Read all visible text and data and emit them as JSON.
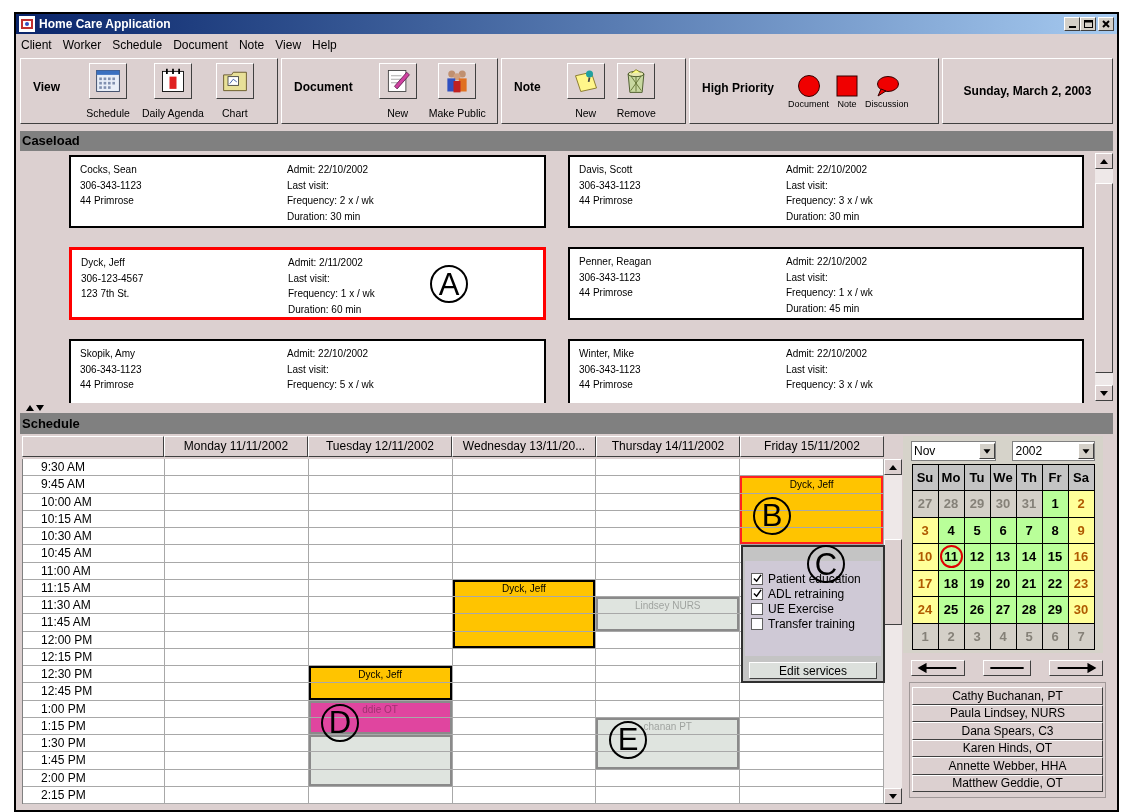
{
  "window": {
    "title": "Home Care Application"
  },
  "menu": [
    "Client",
    "Worker",
    "Schedule",
    "Document",
    "Note",
    "View",
    "Help"
  ],
  "toolbar": {
    "groups": [
      {
        "label": "View",
        "buttons": [
          {
            "label": "Schedule",
            "kind": "calendar"
          },
          {
            "label": "Daily Agenda",
            "kind": "agenda"
          },
          {
            "label": "Chart",
            "kind": "folder"
          }
        ]
      },
      {
        "label": "Document",
        "buttons": [
          {
            "label": "New",
            "kind": "pen"
          },
          {
            "label": "Make Public",
            "kind": "people"
          }
        ]
      },
      {
        "label": "Note",
        "buttons": [
          {
            "label": "New",
            "kind": "note"
          },
          {
            "label": "Remove",
            "kind": "trash"
          }
        ]
      }
    ],
    "high_priority": {
      "label": "High Priority",
      "items": [
        {
          "label": "Document",
          "kind": "circle"
        },
        {
          "label": "Note",
          "kind": "square"
        },
        {
          "label": "Discussion",
          "kind": "bubble"
        }
      ]
    },
    "date": "Sunday, March 2, 2003"
  },
  "caseload": {
    "title": "Caseload",
    "clients": [
      {
        "name": "Cocks, Sean",
        "phone": "306-343-1123",
        "address": "44 Primrose",
        "admit": "Admit: 22/10/2002",
        "last_visit": "Last visit:",
        "frequency": "Frequency: 2 x / wk",
        "duration": "Duration: 30 min",
        "selected": false
      },
      {
        "name": "Davis, Scott",
        "phone": "306-343-1123",
        "address": "44 Primrose",
        "admit": "Admit: 22/10/2002",
        "last_visit": "Last visit:",
        "frequency": "Frequency: 3 x / wk",
        "duration": "Duration: 30 min",
        "selected": false
      },
      {
        "name": "Dyck, Jeff",
        "phone": "306-123-4567",
        "address": "123 7th St.",
        "admit": "Admit: 2/11/2002",
        "last_visit": "Last visit:",
        "frequency": "Frequency: 1 x / wk",
        "duration": "Duration: 60 min",
        "selected": true,
        "callout": "A"
      },
      {
        "name": "Penner, Reagan",
        "phone": "306-343-1123",
        "address": "44 Primrose",
        "admit": "Admit: 22/10/2002",
        "last_visit": "Last visit:",
        "frequency": "Frequency: 1 x / wk",
        "duration": "Duration: 45 min",
        "selected": false
      },
      {
        "name": "Skopik, Amy",
        "phone": "306-343-1123",
        "address": "44 Primrose",
        "admit": "Admit: 22/10/2002",
        "last_visit": "Last visit:",
        "frequency": "Frequency: 5 x / wk",
        "selected": false
      },
      {
        "name": "Winter, Mike",
        "phone": "306-343-1123",
        "address": "44 Primrose",
        "admit": "Admit: 22/10/2002",
        "last_visit": "Last visit:",
        "frequency": "Frequency: 3 x / wk",
        "selected": false
      }
    ]
  },
  "schedule": {
    "title": "Schedule",
    "days": [
      "Monday 11/11/2002",
      "Tuesday 12/11/2002",
      "Wednesday 13/11/20...",
      "Thursday 14/11/2002",
      "Friday 15/11/2002"
    ],
    "rows": [
      {
        "time": "9:30 AM",
        "cells": [
          {},
          {},
          {},
          {},
          {}
        ]
      },
      {
        "time": "9:45 AM",
        "cells": [
          {},
          {},
          {},
          {},
          {
            "kind": "client",
            "color": "#ffc400",
            "selected": true,
            "label": "Dyck, Jeff"
          }
        ]
      },
      {
        "time": "10:00 AM",
        "cells": [
          {},
          {},
          {},
          {},
          {
            "kind": "client",
            "color": "#ffc400",
            "selected": true,
            "callout": "B"
          }
        ]
      },
      {
        "time": "10:15 AM",
        "cells": [
          {},
          {},
          {},
          {},
          {
            "kind": "client",
            "color": "#ffc400",
            "selected": true
          }
        ]
      },
      {
        "time": "10:30 AM",
        "cells": [
          {},
          {},
          {},
          {},
          {
            "kind": "client",
            "color": "#ffc400",
            "selected": true
          }
        ]
      },
      {
        "time": "10:45 AM",
        "cells": [
          {},
          {},
          {},
          {},
          {}
        ]
      },
      {
        "time": "11:00 AM",
        "cells": [
          {},
          {},
          {},
          {},
          {}
        ]
      },
      {
        "time": "11:15 AM",
        "cells": [
          {},
          {},
          {
            "kind": "client",
            "color": "#ffc400",
            "selected": false,
            "label": "Dyck, Jeff"
          },
          {},
          {}
        ]
      },
      {
        "time": "11:30 AM",
        "cells": [
          {},
          {},
          {
            "kind": "client",
            "color": "#ffc400",
            "selected": false
          },
          {
            "kind": "worker",
            "color": "#dfe4df",
            "selected": false,
            "label": "Lindsey NURS"
          },
          {}
        ]
      },
      {
        "time": "11:45 AM",
        "cells": [
          {},
          {},
          {
            "kind": "client",
            "color": "#ffc400",
            "selected": false
          },
          {
            "kind": "worker",
            "color": "#dfe4df",
            "selected": false
          },
          {}
        ]
      },
      {
        "time": "12:00 PM",
        "cells": [
          {},
          {},
          {
            "kind": "client",
            "color": "#ffc400",
            "selected": false
          },
          {},
          {}
        ]
      },
      {
        "time": "12:15 PM",
        "cells": [
          {},
          {},
          {},
          {},
          {}
        ]
      },
      {
        "time": "12:30 PM",
        "cells": [
          {},
          {
            "kind": "client",
            "color": "#ffc400",
            "selected": false,
            "label": "Dyck, Jeff"
          },
          {},
          {},
          {}
        ]
      },
      {
        "time": "12:45 PM",
        "cells": [
          {},
          {
            "kind": "client",
            "color": "#ffc400",
            "selected": false
          },
          {},
          {},
          {}
        ]
      },
      {
        "time": "1:00 PM",
        "cells": [
          {},
          {
            "kind": "worker",
            "color": "#e0459f",
            "selected": false,
            "label": "ddie OT",
            "callout": "D"
          },
          {},
          {},
          {}
        ]
      },
      {
        "time": "1:15 PM",
        "cells": [
          {},
          {
            "kind": "worker",
            "color": "#e0459f",
            "selected": false
          },
          {},
          {
            "kind": "worker",
            "color": "#dfe4df",
            "selected": false,
            "label": "chanan PT",
            "callout": "E"
          },
          {}
        ]
      },
      {
        "time": "1:30 PM",
        "cells": [
          {},
          {
            "kind": "worker",
            "color": "#dfe4df",
            "selected": false
          },
          {},
          {
            "kind": "worker",
            "color": "#dfe4df",
            "selected": false
          },
          {}
        ]
      },
      {
        "time": "1:45 PM",
        "cells": [
          {},
          {
            "kind": "worker",
            "color": "#dfe4df",
            "selected": false
          },
          {},
          {
            "kind": "worker",
            "color": "#dfe4df",
            "selected": false
          },
          {}
        ]
      },
      {
        "time": "2:00 PM",
        "cells": [
          {},
          {
            "kind": "worker",
            "color": "#dfe4df",
            "selected": false
          },
          {},
          {},
          {}
        ]
      },
      {
        "time": "2:15 PM",
        "cells": [
          {},
          {},
          {},
          {},
          {}
        ]
      }
    ],
    "popup": {
      "services": [
        {
          "label": "Patient education",
          "checked": true
        },
        {
          "label": "ADL retraining",
          "checked": true
        },
        {
          "label": "UE Exercise",
          "checked": false
        },
        {
          "label": "Transfer training",
          "checked": false
        }
      ],
      "button": "Edit services",
      "callout": "C"
    }
  },
  "calendar": {
    "month": "Nov",
    "year": "2002",
    "weekdays": [
      "Su",
      "Mo",
      "Tu",
      "We",
      "Th",
      "Fr",
      "Sa"
    ],
    "weeks": [
      [
        {
          "day": "27",
          "kind": "other",
          "selected": false
        },
        {
          "day": "28",
          "kind": "other",
          "selected": false
        },
        {
          "day": "29",
          "kind": "other",
          "selected": false
        },
        {
          "day": "30",
          "kind": "other",
          "selected": false
        },
        {
          "day": "31",
          "kind": "other",
          "selected": false
        },
        {
          "day": "1",
          "kind": "weekday",
          "selected": false
        },
        {
          "day": "2",
          "kind": "weekend",
          "selected": false
        }
      ],
      [
        {
          "day": "3",
          "kind": "weekend",
          "selected": false
        },
        {
          "day": "4",
          "kind": "weekday",
          "selected": false
        },
        {
          "day": "5",
          "kind": "weekday",
          "selected": false
        },
        {
          "day": "6",
          "kind": "weekday",
          "selected": false
        },
        {
          "day": "7",
          "kind": "weekday",
          "selected": false
        },
        {
          "day": "8",
          "kind": "weekday",
          "selected": false
        },
        {
          "day": "9",
          "kind": "weekend",
          "selected": false
        }
      ],
      [
        {
          "day": "10",
          "kind": "weekend",
          "selected": false
        },
        {
          "day": "11",
          "kind": "weekday",
          "selected": true
        },
        {
          "day": "12",
          "kind": "weekday",
          "selected": false
        },
        {
          "day": "13",
          "kind": "weekday",
          "selected": false
        },
        {
          "day": "14",
          "kind": "weekday",
          "selected": false
        },
        {
          "day": "15",
          "kind": "weekday",
          "selected": false
        },
        {
          "day": "16",
          "kind": "weekend",
          "selected": false
        }
      ],
      [
        {
          "day": "17",
          "kind": "weekend",
          "selected": false
        },
        {
          "day": "18",
          "kind": "weekday",
          "selected": false
        },
        {
          "day": "19",
          "kind": "weekday",
          "selected": false
        },
        {
          "day": "20",
          "kind": "weekday",
          "selected": false
        },
        {
          "day": "21",
          "kind": "weekday",
          "selected": false
        },
        {
          "day": "22",
          "kind": "weekday",
          "selected": false
        },
        {
          "day": "23",
          "kind": "weekend",
          "selected": false
        }
      ],
      [
        {
          "day": "24",
          "kind": "weekend",
          "selected": false
        },
        {
          "day": "25",
          "kind": "weekday",
          "selected": false
        },
        {
          "day": "26",
          "kind": "weekday",
          "selected": false
        },
        {
          "day": "27",
          "kind": "weekday",
          "selected": false
        },
        {
          "day": "28",
          "kind": "weekday",
          "selected": false
        },
        {
          "day": "29",
          "kind": "weekday",
          "selected": false
        },
        {
          "day": "30",
          "kind": "weekend",
          "selected": false
        }
      ],
      [
        {
          "day": "1",
          "kind": "other",
          "selected": false
        },
        {
          "day": "2",
          "kind": "other",
          "selected": false
        },
        {
          "day": "3",
          "kind": "other",
          "selected": false
        },
        {
          "day": "4",
          "kind": "other",
          "selected": false
        },
        {
          "day": "5",
          "kind": "other",
          "selected": false
        },
        {
          "day": "6",
          "kind": "other",
          "selected": false
        },
        {
          "day": "7",
          "kind": "other",
          "selected": false
        }
      ]
    ]
  },
  "workers": [
    "Cathy Buchanan, PT",
    "Paula Lindsey, NURS",
    "Dana Spears, C3",
    "Karen Hinds, OT",
    "Annette Webber, HHA",
    "Matthew Geddie, OT"
  ]
}
